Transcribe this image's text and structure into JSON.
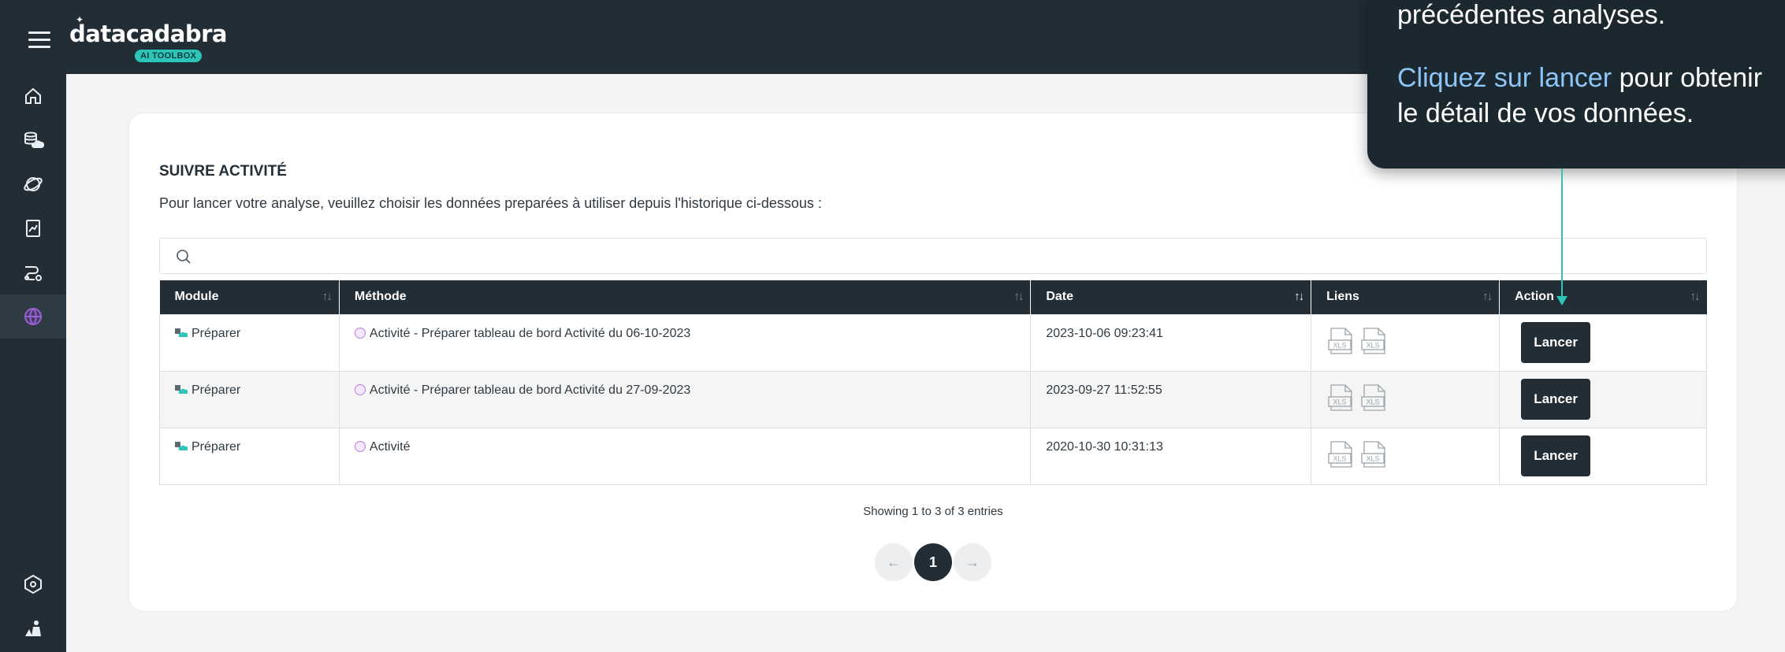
{
  "header": {
    "logo_text": "datacadabra",
    "logo_badge": "AI TOOLBOX"
  },
  "sidebar": {
    "items": [
      {
        "icon": "home-icon"
      },
      {
        "icon": "database-cloud-icon"
      },
      {
        "icon": "orbit-icon"
      },
      {
        "icon": "report-chart-icon"
      },
      {
        "icon": "workflow-icon"
      },
      {
        "icon": "activity-globe-icon",
        "active": true
      },
      {
        "icon": "hexagon-settings-icon"
      },
      {
        "icon": "user-tools-icon"
      }
    ]
  },
  "main": {
    "title": "SUIVRE ACTIVITÉ",
    "description": "Pour lancer votre analyse, veuillez choisir les données preparées à utiliser depuis l'historique ci-dessous :",
    "search_placeholder": "",
    "table": {
      "columns": [
        "Module",
        "Méthode",
        "Date",
        "Liens",
        "Action"
      ],
      "rows": [
        {
          "module": "Préparer",
          "methode": "Activité - Préparer tableau de bord Activité du 06-10-2023",
          "date": "2023-10-06 09:23:41",
          "links": [
            "XLS",
            "XLS"
          ],
          "action": "Lancer"
        },
        {
          "module": "Préparer",
          "methode": "Activité - Préparer tableau de bord Activité du 27-09-2023",
          "date": "2023-09-27 11:52:55",
          "links": [
            "XLS",
            "XLS"
          ],
          "action": "Lancer"
        },
        {
          "module": "Préparer",
          "methode": "Activité",
          "date": "2020-10-30 10:31:13",
          "links": [
            "XLS",
            "XLS"
          ],
          "action": "Lancer"
        }
      ]
    },
    "entries_info": "Showing 1 to 3 of 3 entries",
    "pagination": {
      "prev": "←",
      "current": "1",
      "next": "→"
    }
  },
  "tooltip": {
    "line1": "précédentes analyses.",
    "link_text": "Cliquez sur lancer",
    "line2_rest": " pour obtenir",
    "line3": "le détail de vos données."
  },
  "colors": {
    "dark": "#222d35",
    "accent": "#2ec4b6",
    "link": "#8ec5f7"
  }
}
